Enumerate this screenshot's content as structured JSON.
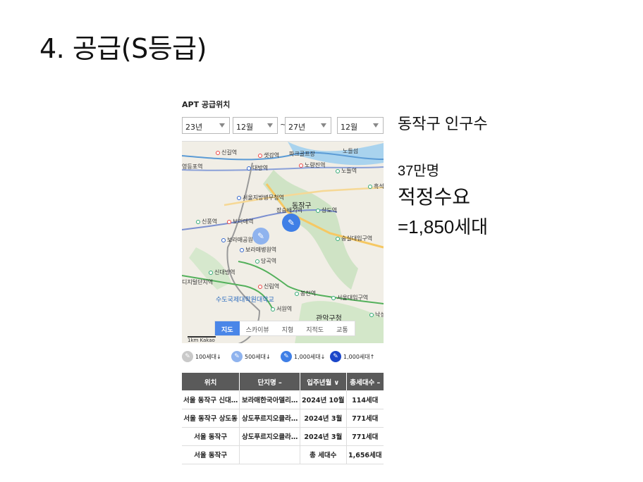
{
  "slide": {
    "title": "4. 공급(S등급)"
  },
  "panel": {
    "title": "APT 공급위치",
    "filters": {
      "start_year": "23년",
      "start_month": "12월",
      "separator": "~",
      "end_year": "27년",
      "end_month": "12월"
    },
    "map": {
      "stations": [
        "신길역",
        "샛강역",
        "파크골프장",
        "노들섬",
        "영등포역",
        "대방역",
        "노량진역",
        "노들역",
        "흑석",
        "서울지방병무청역",
        "동작구",
        "장승배기역",
        "상도역",
        "신풍역",
        "보라매역",
        "숭실대입구역",
        "보라매공원",
        "보라매병원역",
        "당곡역",
        "신대방역",
        "디지털단지역",
        "신림역",
        "봉천역",
        "서울대입구역",
        "수도국제대학원대학교",
        "서원역",
        "관악구청",
        "낙성"
      ],
      "tabs": [
        "지도",
        "스카이뷰",
        "지형",
        "지적도",
        "교통"
      ],
      "active_tab": "지도",
      "scale_label": "1km Kakao"
    },
    "legend": [
      {
        "label": "100세대↓",
        "color": "#c9c9c9"
      },
      {
        "label": "500세대↓",
        "color": "#8fb3ee"
      },
      {
        "label": "1,000세대↓",
        "color": "#3f7fe6"
      },
      {
        "label": "1,000세대↑",
        "color": "#1b46c9"
      }
    ],
    "table": {
      "headers": [
        "위치",
        "단지명 –",
        "입주년월 ∨",
        "총세대수 –"
      ],
      "rows": [
        [
          "서울 동작구 신대…",
          "보라매한국아델리…",
          "2024년 10월",
          "114세대"
        ],
        [
          "서울 동작구 상도동",
          "상도푸르지오클라…",
          "2024년 3월",
          "771세대"
        ],
        [
          "서울 동작구",
          "상도푸르지오클라…",
          "2024년 3월",
          "771세대"
        ],
        [
          "서울 동작구",
          "",
          "총 세대수",
          "1,656세대"
        ]
      ]
    }
  },
  "side": {
    "line1": "동작구 인구수",
    "line2": "37만명",
    "line3": "적정수요",
    "line4": "=1,850세대"
  }
}
